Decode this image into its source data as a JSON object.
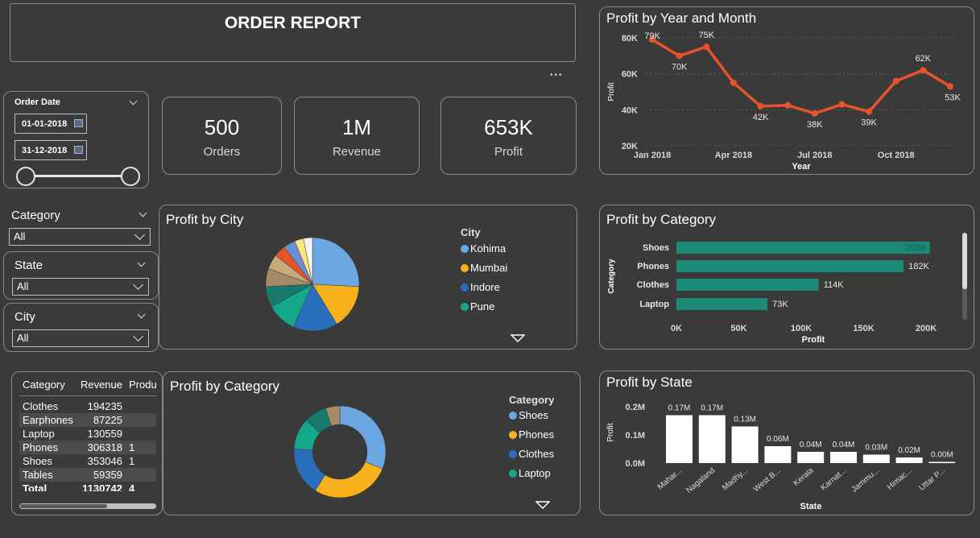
{
  "header": {
    "title": "ORDER REPORT"
  },
  "more_options": "•••",
  "slicers": {
    "order_date": {
      "label": "Order Date",
      "start": "01-01-2018",
      "end": "31-12-2018"
    },
    "category": {
      "label": "Category",
      "value": "All"
    },
    "state": {
      "label": "State",
      "value": "All"
    },
    "city": {
      "label": "City",
      "value": "All"
    }
  },
  "kpis": [
    {
      "value": "500",
      "label": "Orders"
    },
    {
      "value": "1M",
      "label": "Revenue"
    },
    {
      "value": "653K",
      "label": "Profit"
    }
  ],
  "table": {
    "headers": [
      "Category",
      "Revenue",
      "Produ"
    ],
    "rows": [
      [
        "Clothes",
        "194235",
        ""
      ],
      [
        "Earphones",
        "87225",
        ""
      ],
      [
        "Laptop",
        "130559",
        ""
      ],
      [
        "Phones",
        "306318",
        "1"
      ],
      [
        "Shoes",
        "353046",
        "1"
      ],
      [
        "Tables",
        "59359",
        ""
      ]
    ],
    "total": [
      "Total",
      "1130742",
      "4"
    ]
  },
  "colors": {
    "line": "#e8542a",
    "bar": "#1a8a76",
    "state_bar": "#ffffff",
    "background": "#3a3a3a"
  },
  "chart_data": [
    {
      "id": "profit-by-year-month",
      "type": "line",
      "title": "Profit by Year and Month",
      "xlabel": "Year",
      "ylabel": "Profit",
      "x": [
        "2018-01",
        "2018-02",
        "2018-03",
        "2018-04",
        "2018-05",
        "2018-06",
        "2018-07",
        "2018-08",
        "2018-09",
        "2018-10",
        "2018-11",
        "2018-12"
      ],
      "values": [
        79,
        70,
        75,
        55,
        42,
        42.5,
        38,
        43,
        39,
        56,
        62,
        53
      ],
      "data_labels": [
        "79K",
        "70K",
        "75K",
        "",
        "42K",
        "",
        "38K",
        "",
        "39K",
        "",
        "62K",
        "53K"
      ],
      "xticks": [
        "Jan 2018",
        "Apr 2018",
        "Jul 2018",
        "Oct 2018"
      ],
      "yticks": [
        "80K",
        "60K",
        "40K",
        "20K"
      ],
      "ylim": [
        20,
        80
      ]
    },
    {
      "id": "profit-by-city",
      "type": "pie",
      "title": "Profit by City",
      "legend_title": "City",
      "legend": [
        "Kohima",
        "Mumbai",
        "Indore",
        "Pune"
      ],
      "values": [
        25,
        15,
        15,
        10,
        7,
        6,
        5,
        4,
        4,
        3,
        3
      ],
      "colors": [
        "#6aa7e3",
        "#f7b21b",
        "#2a6fbd",
        "#13a88a",
        "#177a6d",
        "#a78b68",
        "#c7ac7a",
        "#e8542a",
        "#6a8fd9",
        "#ffe57a",
        "#f4f4f4"
      ]
    },
    {
      "id": "profit-by-category-bar",
      "type": "bar",
      "title": "Profit by Category",
      "xlabel": "Profit",
      "ylabel": "Category",
      "categories": [
        "Shoes",
        "Phones",
        "Clothes",
        "Laptop"
      ],
      "values": [
        203,
        182,
        114,
        73
      ],
      "data_labels": [
        "203K",
        "182K",
        "114K",
        "73K"
      ],
      "xticks": [
        "0K",
        "50K",
        "100K",
        "150K",
        "200K"
      ],
      "xlim": [
        0,
        200
      ]
    },
    {
      "id": "profit-by-category-donut",
      "type": "pie",
      "title": "Profit by Category",
      "legend_title": "Category",
      "legend": [
        "Shoes",
        "Phones",
        "Clothes",
        "Laptop"
      ],
      "values": [
        31,
        28,
        17,
        11,
        8,
        5
      ],
      "colors": [
        "#6aa7e3",
        "#f7b21b",
        "#2a6fbd",
        "#13a88a",
        "#177a6d",
        "#a78b68"
      ]
    },
    {
      "id": "profit-by-state",
      "type": "bar",
      "title": "Profit by State",
      "xlabel": "State",
      "ylabel": "Profit",
      "categories": [
        "Mahar...",
        "Nagaland",
        "Madhy...",
        "West B...",
        "Kerala",
        "Karnat...",
        "Jammu...",
        "Himac...",
        "Uttar P..."
      ],
      "values": [
        0.17,
        0.17,
        0.13,
        0.06,
        0.04,
        0.04,
        0.03,
        0.02,
        0.0
      ],
      "data_labels": [
        "0.17M",
        "0.17M",
        "0.13M",
        "0.06M",
        "0.04M",
        "0.04M",
        "0.03M",
        "0.02M",
        "0.00M"
      ],
      "yticks": [
        "0.2M",
        "0.1M",
        "0.0M"
      ],
      "ylim": [
        0,
        0.2
      ]
    }
  ]
}
